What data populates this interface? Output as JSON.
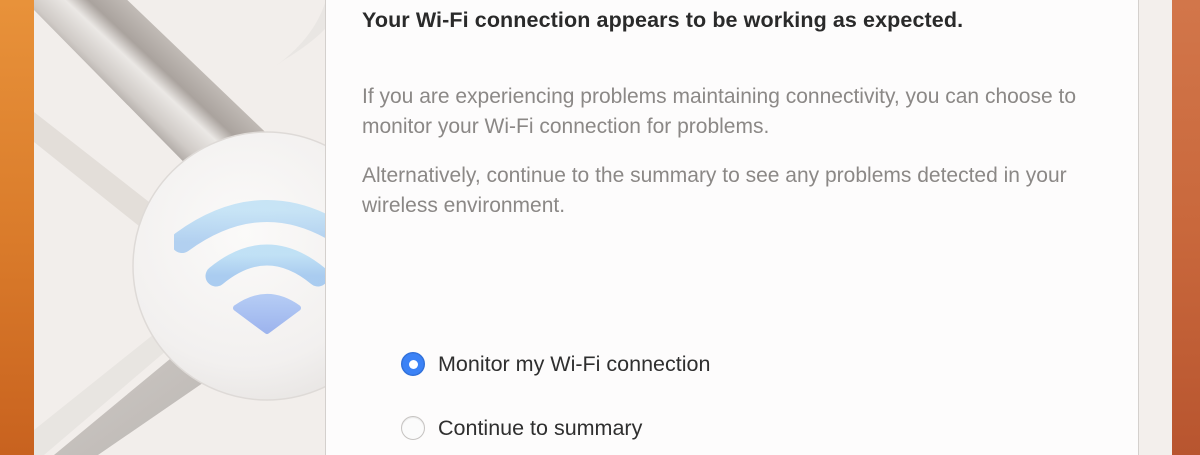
{
  "assistant": {
    "heading": "Your Wi-Fi connection appears to be working as expected.",
    "paragraph1": "If you are experiencing problems maintaining connectivity, you can choose to monitor your Wi-Fi connection for problems.",
    "paragraph2": "Alternatively, continue to the summary to see any problems detected in your wireless environment.",
    "options": [
      {
        "label": "Monitor my Wi-Fi connection",
        "selected": true
      },
      {
        "label": "Continue to summary",
        "selected": false
      }
    ]
  },
  "icons": {
    "illustration": "wifi-diagnostics-wrench-icon",
    "wifi": "wifi-icon"
  },
  "colors": {
    "accent": "#3b82f6",
    "wifi_blue": "#a9d2f0",
    "heading_text": "#2a2a2a",
    "body_text": "#8b8886"
  }
}
